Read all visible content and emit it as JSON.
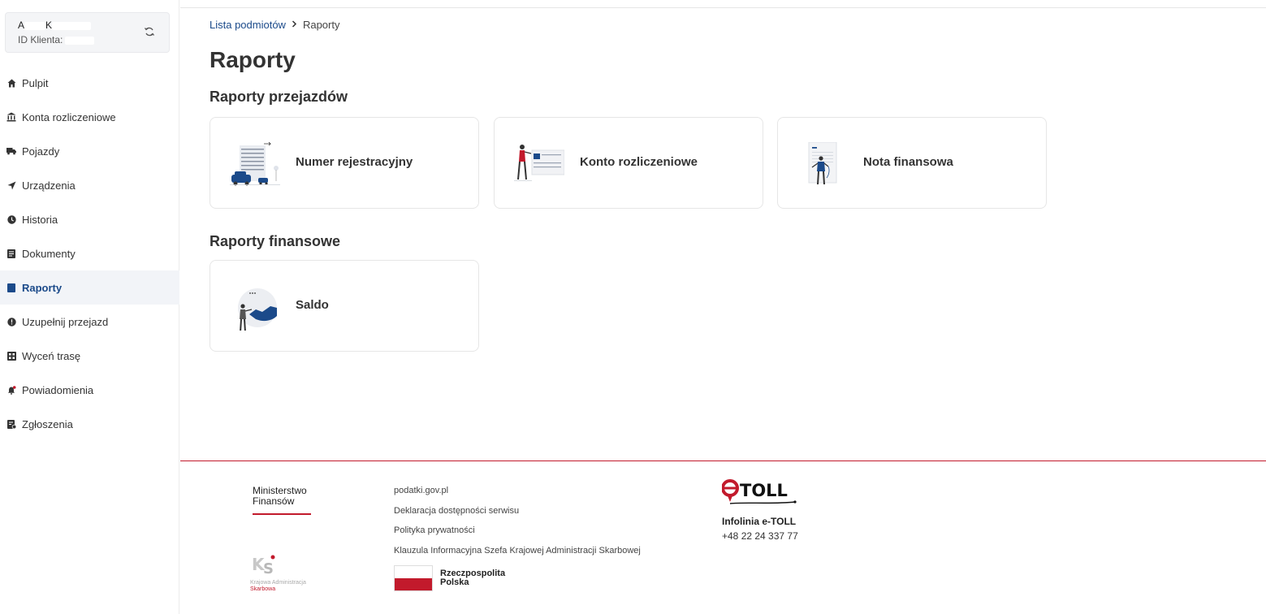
{
  "client": {
    "name_initial_1": "A",
    "name_initial_2": "K",
    "id_label": "ID Klienta:"
  },
  "sidebar": {
    "items": [
      {
        "label": "Pulpit",
        "icon": "home-icon"
      },
      {
        "label": "Konta rozliczeniowe",
        "icon": "bank-icon"
      },
      {
        "label": "Pojazdy",
        "icon": "truck-icon"
      },
      {
        "label": "Urządzenia",
        "icon": "navigation-arrow-icon"
      },
      {
        "label": "Historia",
        "icon": "clock-icon"
      },
      {
        "label": "Dokumenty",
        "icon": "document-icon"
      },
      {
        "label": "Raporty",
        "icon": "report-icon",
        "active": true
      },
      {
        "label": "Uzupełnij przejazd",
        "icon": "alert-circle-icon"
      },
      {
        "label": "Wyceń trasę",
        "icon": "calculator-icon"
      },
      {
        "label": "Powiadomienia",
        "icon": "bell-icon"
      },
      {
        "label": "Zgłoszenia",
        "icon": "ticket-icon"
      }
    ]
  },
  "breadcrumb": {
    "parent": "Lista podmiotów",
    "current": "Raporty"
  },
  "page": {
    "title": "Raporty",
    "section_trips": "Raporty przejazdów",
    "section_finance": "Raporty finansowe",
    "cards_trips": [
      {
        "label": "Numer rejestracyjny",
        "icon": "vehicle-building-illustration"
      },
      {
        "label": "Konto rozliczeniowe",
        "icon": "person-board-illustration"
      },
      {
        "label": "Nota finansowa",
        "icon": "person-document-illustration"
      }
    ],
    "cards_finance": [
      {
        "label": "Saldo",
        "icon": "person-chart-illustration"
      }
    ]
  },
  "footer": {
    "ministry_line1": "Ministerstwo",
    "ministry_line2": "Finansów",
    "kas_line1": "Krajowa Administracja",
    "kas_line2": "Skarbowa",
    "links": [
      "podatki.gov.pl",
      "Deklaracja dostępności serwisu",
      "Polityka prywatności",
      "Klauzula Informacyjna Szefa Krajowej Administracji Skarbowej"
    ],
    "rp_line1": "Rzeczpospolita",
    "rp_line2": "Polska",
    "etoll_logo": "eTOLL",
    "infoline_title": "Infolinia e-TOLL",
    "infoline_phone": "+48 22 24 337 77"
  },
  "colors": {
    "accent_blue": "#1b4a8a",
    "brand_red": "#c21a2c",
    "active_bg": "#f2f4f8"
  }
}
